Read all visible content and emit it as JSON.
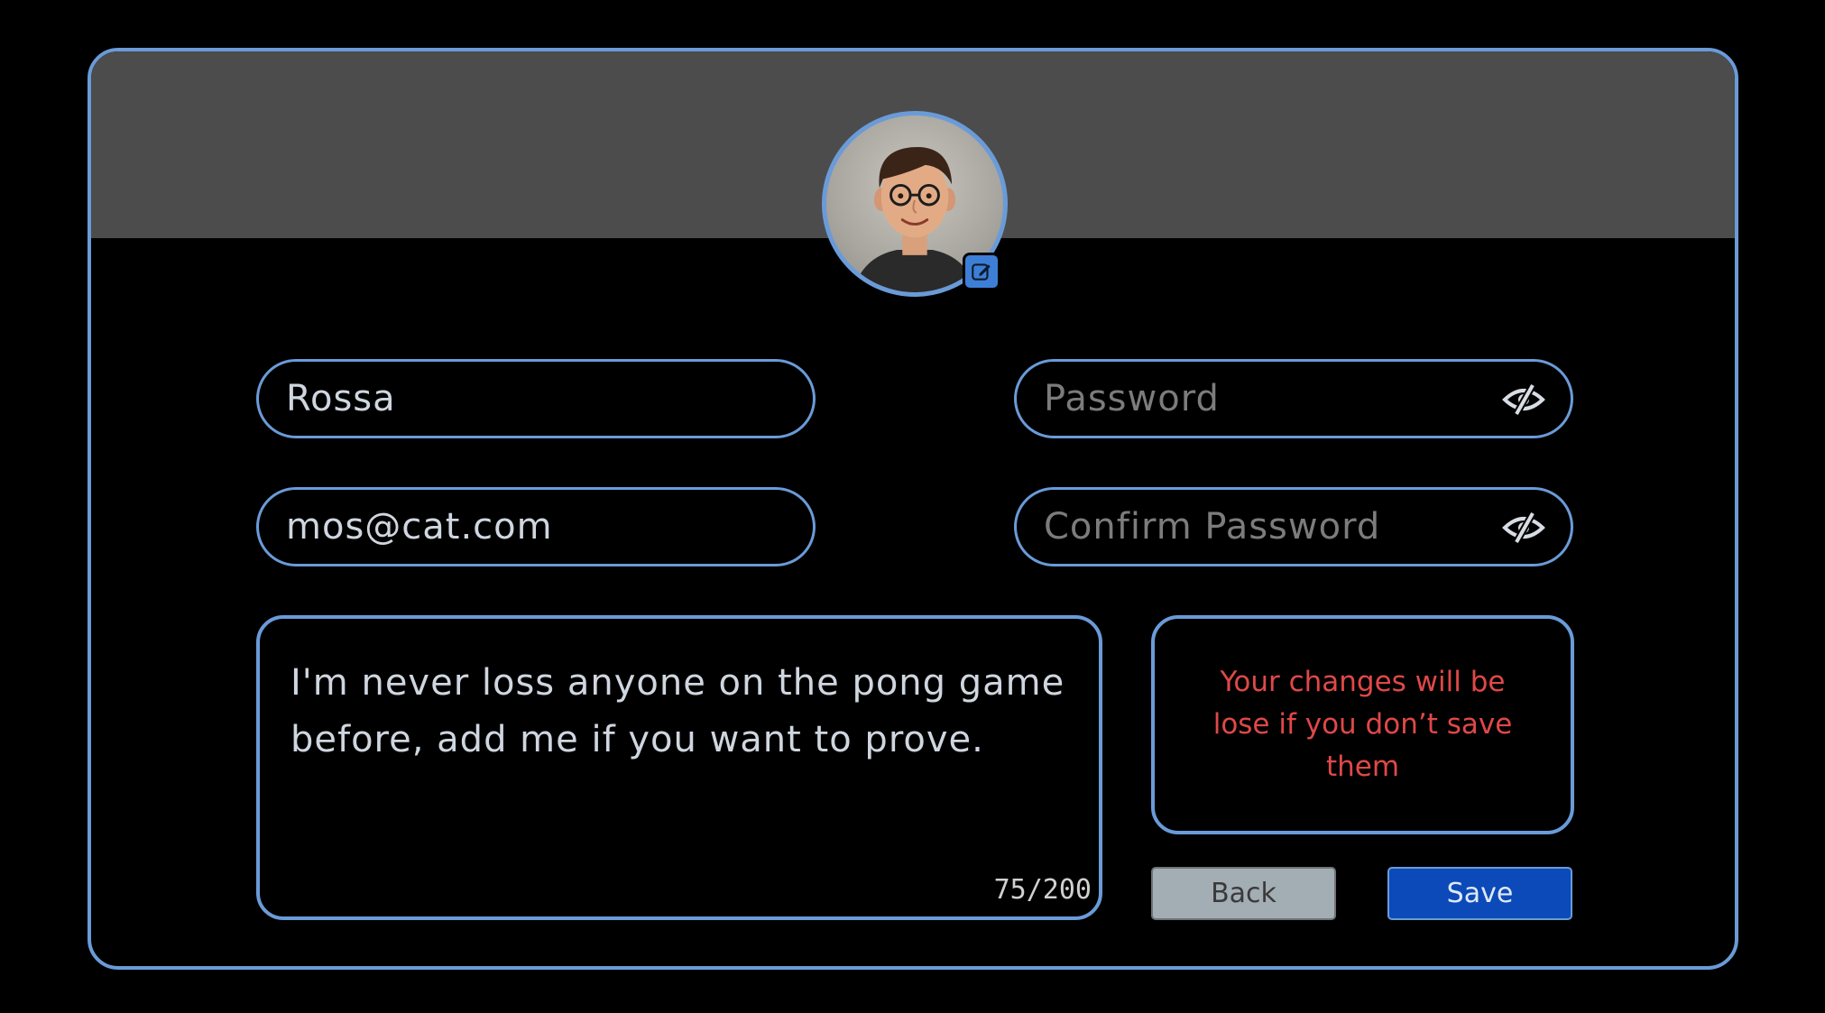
{
  "profile": {
    "username": "Rossa",
    "email": "mos@cat.com",
    "password_placeholder": "Password",
    "confirm_password_placeholder": "Confirm Password",
    "bio": "I'm never loss anyone on the pong game before, add me if you want to prove.",
    "bio_counter": "75/200"
  },
  "warning": {
    "text": "Your changes will be lose if you don’t save them"
  },
  "buttons": {
    "back_label": "Back",
    "save_label": "Save"
  },
  "icons": {
    "edit_avatar": "edit-pencil-icon",
    "password_toggle": "eye-slash-icon",
    "confirm_toggle": "eye-slash-icon"
  },
  "colors": {
    "accent": "#6a9bd8",
    "banner": "#4c4c4c",
    "warning": "#e04848",
    "save_button": "#0b4ab8",
    "back_button": "#a3adb4"
  }
}
